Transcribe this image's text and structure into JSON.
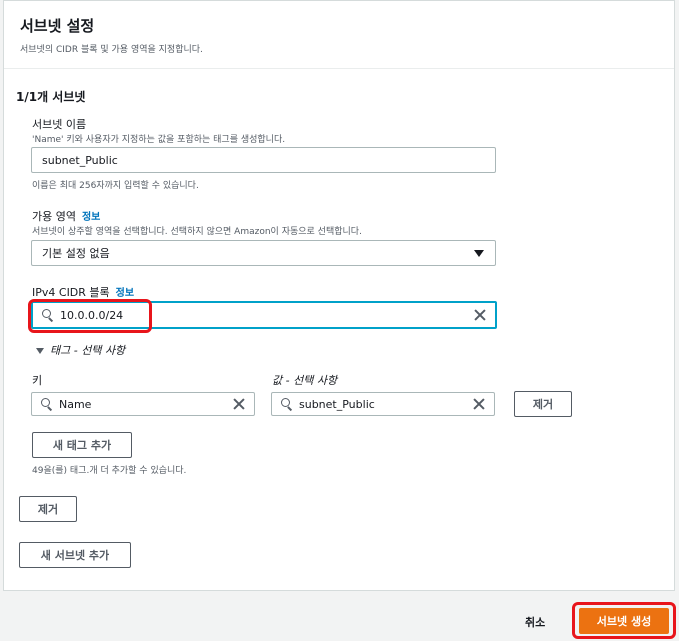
{
  "header": {
    "title": "서브넷 설정",
    "description": "서브넷의 CIDR 블록 및 가용 영역을 지정합니다."
  },
  "section": {
    "title": "1/1개 서브넷"
  },
  "subnet_name": {
    "label": "서브넷 이름",
    "description": "'Name' 키와 사용자가 지정하는 값을 포함하는 태그를 생성합니다.",
    "value": "subnet_Public",
    "constraint": "이름은 최대 256자까지 입력할 수 있습니다."
  },
  "availability_zone": {
    "label": "가용 영역",
    "info": "정보",
    "description": "서브넷이 상주할 영역을 선택합니다. 선택하지 않으면 Amazon이 자동으로 선택합니다.",
    "selected": "기본 설정 없음"
  },
  "ipv4_cidr": {
    "label": "IPv4 CIDR 블록",
    "info": "정보",
    "value": "10.0.0.0/24"
  },
  "tags": {
    "toggle_label": "태그 - 선택 사항",
    "key_header": "키",
    "value_header": "값 - 선택 사항",
    "key_value": "Name",
    "value_value": "subnet_Public",
    "remove_label": "제거",
    "add_label": "새 태그 추가",
    "remaining": "49을(를) 태그.개 더 추가할 수 있습니다."
  },
  "remove_subnet_label": "제거",
  "add_subnet_label": "새 서브넷 추가",
  "footer": {
    "cancel_label": "취소",
    "create_label": "서브넷 생성"
  },
  "colors": {
    "primary": "#ec7211",
    "link": "#0073bb",
    "focus": "#00a1c9",
    "annotation": "#e8151b"
  }
}
